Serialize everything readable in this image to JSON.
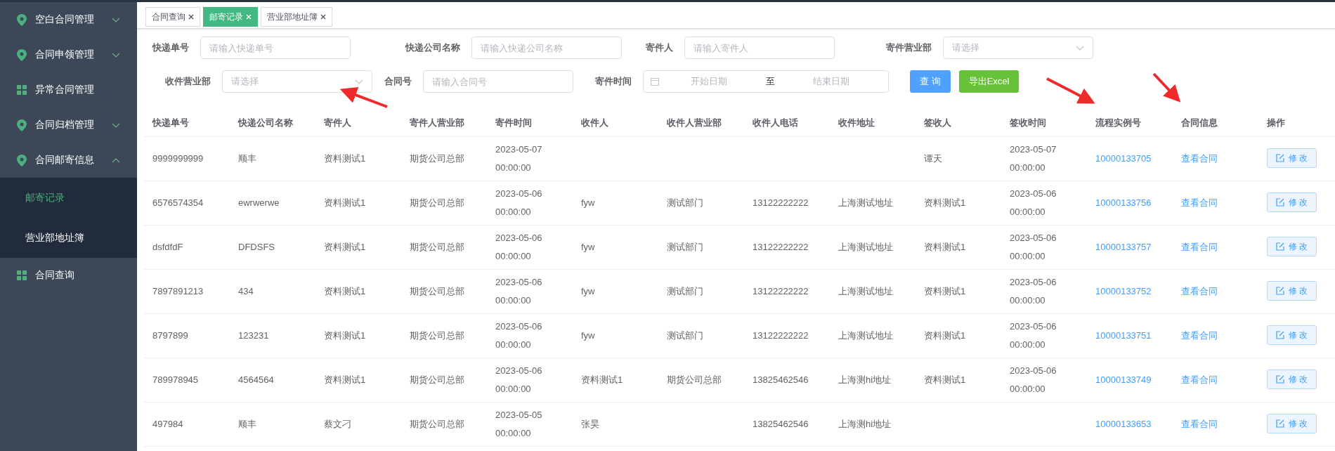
{
  "sidebar": {
    "items": [
      {
        "label": "空白合同管理",
        "kind": "pin",
        "expanded": false
      },
      {
        "label": "合同申领管理",
        "kind": "pin",
        "expanded": false
      },
      {
        "label": "异常合同管理",
        "kind": "grid"
      },
      {
        "label": "合同归档管理",
        "kind": "pin",
        "expanded": false
      },
      {
        "label": "合同邮寄信息",
        "kind": "pin",
        "expanded": true,
        "children": [
          {
            "label": "邮寄记录",
            "selected": true
          },
          {
            "label": "营业部地址簿",
            "selected": false
          }
        ]
      },
      {
        "label": "合同查询",
        "kind": "grid"
      }
    ]
  },
  "tabs": [
    {
      "label": "合同查询",
      "selected": false
    },
    {
      "label": "邮寄记录",
      "selected": true
    },
    {
      "label": "营业部地址簿",
      "selected": false
    }
  ],
  "filters": [
    {
      "kind": "text",
      "label": "快递单号",
      "placeholder": "请输入快递单号"
    },
    {
      "kind": "text",
      "label": "快递公司名称",
      "placeholder": "请输入快递公司名称"
    },
    {
      "kind": "text",
      "label": "寄件人",
      "placeholder": "请输入寄件人"
    },
    {
      "kind": "select",
      "label": "寄件营业部",
      "placeholder": "请选择"
    },
    {
      "kind": "select",
      "label": "收件营业部",
      "placeholder": "请选择"
    },
    {
      "kind": "text",
      "label": "合同号",
      "placeholder": "请输入合同号"
    },
    {
      "kind": "daterange",
      "label": "寄件时间",
      "start_placeholder": "开始日期",
      "separator": "至",
      "end_placeholder": "结束日期"
    }
  ],
  "buttons": [
    {
      "kind": "primary",
      "label": "查 询"
    },
    {
      "kind": "success",
      "label": "导出Excel"
    }
  ],
  "table": {
    "columns": [
      {
        "label": "快递单号",
        "kind": "text"
      },
      {
        "label": "快递公司名称",
        "kind": "text"
      },
      {
        "label": "寄件人",
        "kind": "text"
      },
      {
        "label": "寄件人营业部",
        "kind": "text"
      },
      {
        "label": "寄件时间",
        "kind": "text"
      },
      {
        "label": "收件人",
        "kind": "text"
      },
      {
        "label": "收件人营业部",
        "kind": "text"
      },
      {
        "label": "收件人电话",
        "kind": "text"
      },
      {
        "label": "收件地址",
        "kind": "text"
      },
      {
        "label": "签收人",
        "kind": "text"
      },
      {
        "label": "签收时间",
        "kind": "text"
      },
      {
        "label": "流程实例号",
        "kind": "link"
      },
      {
        "label": "合同信息",
        "kind": "link"
      },
      {
        "label": "操作",
        "kind": "action"
      }
    ],
    "rows": [
      [
        "9999999999",
        "顺丰",
        "资料测试1",
        "期货公司总部",
        "2023-05-07 00:00:00",
        "",
        "",
        "",
        "",
        "谭天",
        "2023-05-07 00:00:00",
        "10000133705",
        "查看合同",
        "修 改"
      ],
      [
        "6576574354",
        "ewrwerwe",
        "资料测试1",
        "期货公司总部",
        "2023-05-06 00:00:00",
        "fyw",
        "测试部门",
        "13122222222",
        "上海测试地址",
        "资料测试1",
        "2023-05-06 00:00:00",
        "10000133756",
        "查看合同",
        "修 改"
      ],
      [
        "dsfdfdF",
        "DFDSFS",
        "资料测试1",
        "期货公司总部",
        "2023-05-06 00:00:00",
        "fyw",
        "测试部门",
        "13122222222",
        "上海测试地址",
        "资料测试1",
        "2023-05-06 00:00:00",
        "10000133757",
        "查看合同",
        "修 改"
      ],
      [
        "7897891213",
        "434",
        "资料测试1",
        "期货公司总部",
        "2023-05-06 00:00:00",
        "fyw",
        "测试部门",
        "13122222222",
        "上海测试地址",
        "资料测试1",
        "2023-05-06 00:00:00",
        "10000133752",
        "查看合同",
        "修 改"
      ],
      [
        "8797899",
        "123231",
        "资料测试1",
        "期货公司总部",
        "2023-05-06 00:00:00",
        "fyw",
        "测试部门",
        "13122222222",
        "上海测试地址",
        "资料测试1",
        "2023-05-06 00:00:00",
        "10000133751",
        "查看合同",
        "修 改"
      ],
      [
        "789978945",
        "4564564",
        "资料测试1",
        "期货公司总部",
        "2023-05-06 00:00:00",
        "资料测试1",
        "期货公司总部",
        "13825462546",
        "上海测hi地址",
        "资料测试1",
        "2023-05-06 00:00:00",
        "10000133749",
        "查看合同",
        "修 改"
      ],
      [
        "497984",
        "顺丰",
        "蔡文刁",
        "期货公司总部",
        "2023-05-05 00:00:00",
        "张昊",
        "",
        "13825462546",
        "上海测hi地址",
        "",
        "",
        "10000133653",
        "查看合同",
        "修 改"
      ]
    ]
  }
}
